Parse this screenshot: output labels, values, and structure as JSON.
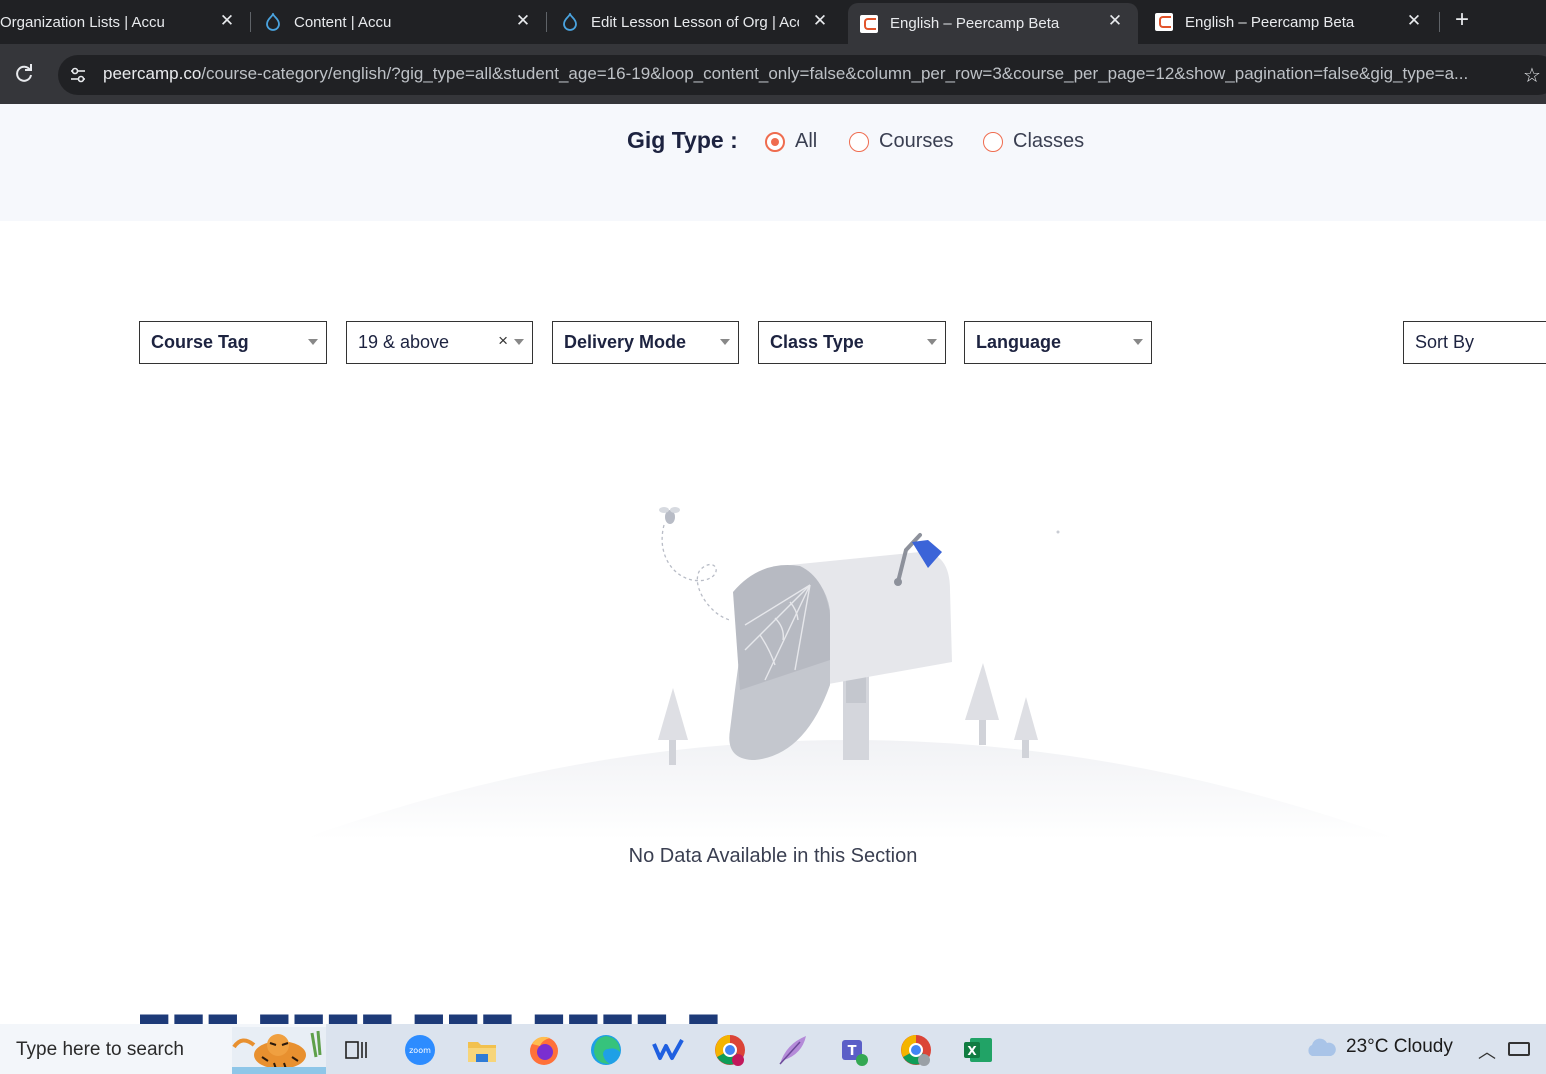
{
  "browser": {
    "tabs": [
      {
        "title": "Organization Lists | Accu",
        "favicon": "drupal-icon"
      },
      {
        "title": "Content | Accu",
        "favicon": "drupal-icon"
      },
      {
        "title": "Edit Lesson Lesson of Org | Accu",
        "favicon": "drupal-icon"
      },
      {
        "title": "English – Peercamp Beta",
        "favicon": "peercamp-icon",
        "active": true
      },
      {
        "title": "English – Peercamp Beta",
        "favicon": "peercamp-icon"
      }
    ],
    "url_host": "peercamp.co",
    "url_path": "/course-category/english/?gig_type=all&student_age=16-19&loop_content_only=false&column_per_row=3&course_per_page=12&show_pagination=false&gig_type=a..."
  },
  "page": {
    "gig_type": {
      "label": "Gig Type :",
      "options": [
        "All",
        "Courses",
        "Classes"
      ],
      "selected": "All"
    },
    "filters": {
      "course_tag": "Course Tag",
      "age": "19 & above",
      "delivery_mode": "Delivery Mode",
      "class_type": "Class Type",
      "language": "Language",
      "sort_by": "Sort By"
    },
    "empty_message": "No Data Available in this Section",
    "accent_color": "#ef6c4f",
    "heading_color": "#1d2340"
  },
  "taskbar": {
    "search_placeholder": "Type here to search",
    "apps": [
      "task-view-icon",
      "zoom-icon",
      "file-explorer-icon",
      "firefox-icon",
      "edge-icon",
      "wps-icon",
      "chrome-icon",
      "feather-icon",
      "teams-icon",
      "chrome-profile-icon",
      "excel-icon"
    ],
    "weather": "23°C  Cloudy"
  }
}
